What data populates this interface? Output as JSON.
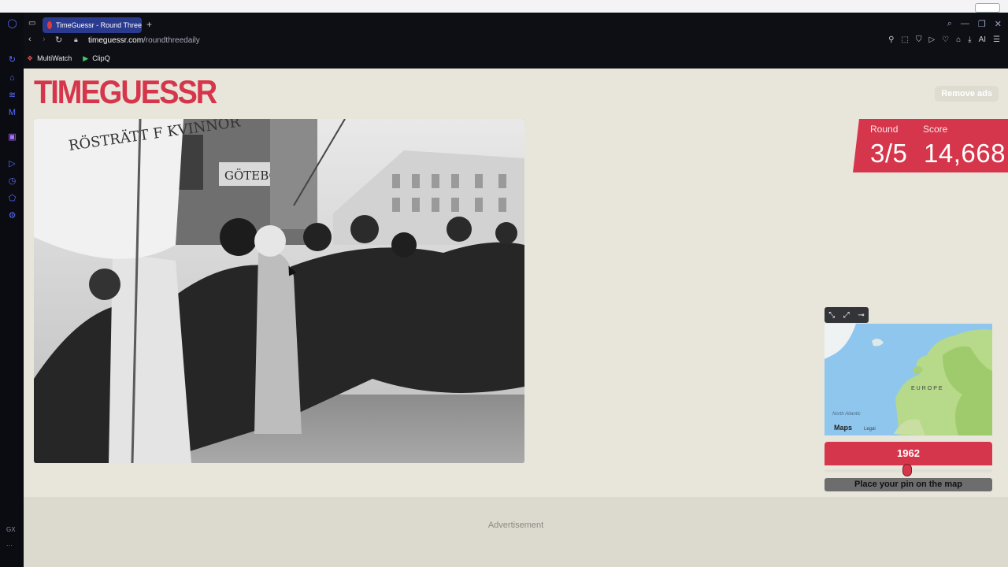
{
  "browser": {
    "tab_title": "TimeGuessr - Round Three",
    "url_domain": "timeguessr.com",
    "url_path": "/roundthreedaily",
    "bookmarks": [
      {
        "label": "MultiWatch",
        "icon": "multiwatch-icon"
      },
      {
        "label": "ClipQ",
        "icon": "play-icon"
      }
    ],
    "toolbar_ai_label": "AI",
    "sidebar_gx_label": "GX"
  },
  "page": {
    "logo": "TIMEGUESSR",
    "remove_ads": "Remove ads",
    "photo_caption_sign_1": "GÖTEBORGS",
    "photo_caption_banner": "RÖSTRÄTT F KVINNOR"
  },
  "score": {
    "round_label": "Round",
    "score_label": "Score",
    "round_value": "3/5",
    "score_value": "14,668"
  },
  "map": {
    "region_label": "EUROPE",
    "ocean_label": "North Atlantic",
    "attribution": "Maps",
    "legal": "Legal"
  },
  "year": {
    "value": "1962",
    "slider_fraction": 0.49
  },
  "actions": {
    "place_pin": "Place your pin on the map"
  },
  "advertisement": {
    "label": "Advertisement"
  },
  "colors": {
    "brand_red": "#d6364b",
    "page_bg": "#e8e6da",
    "browser_bg": "#0e0f14",
    "active_tab": "#2a3a8f"
  }
}
